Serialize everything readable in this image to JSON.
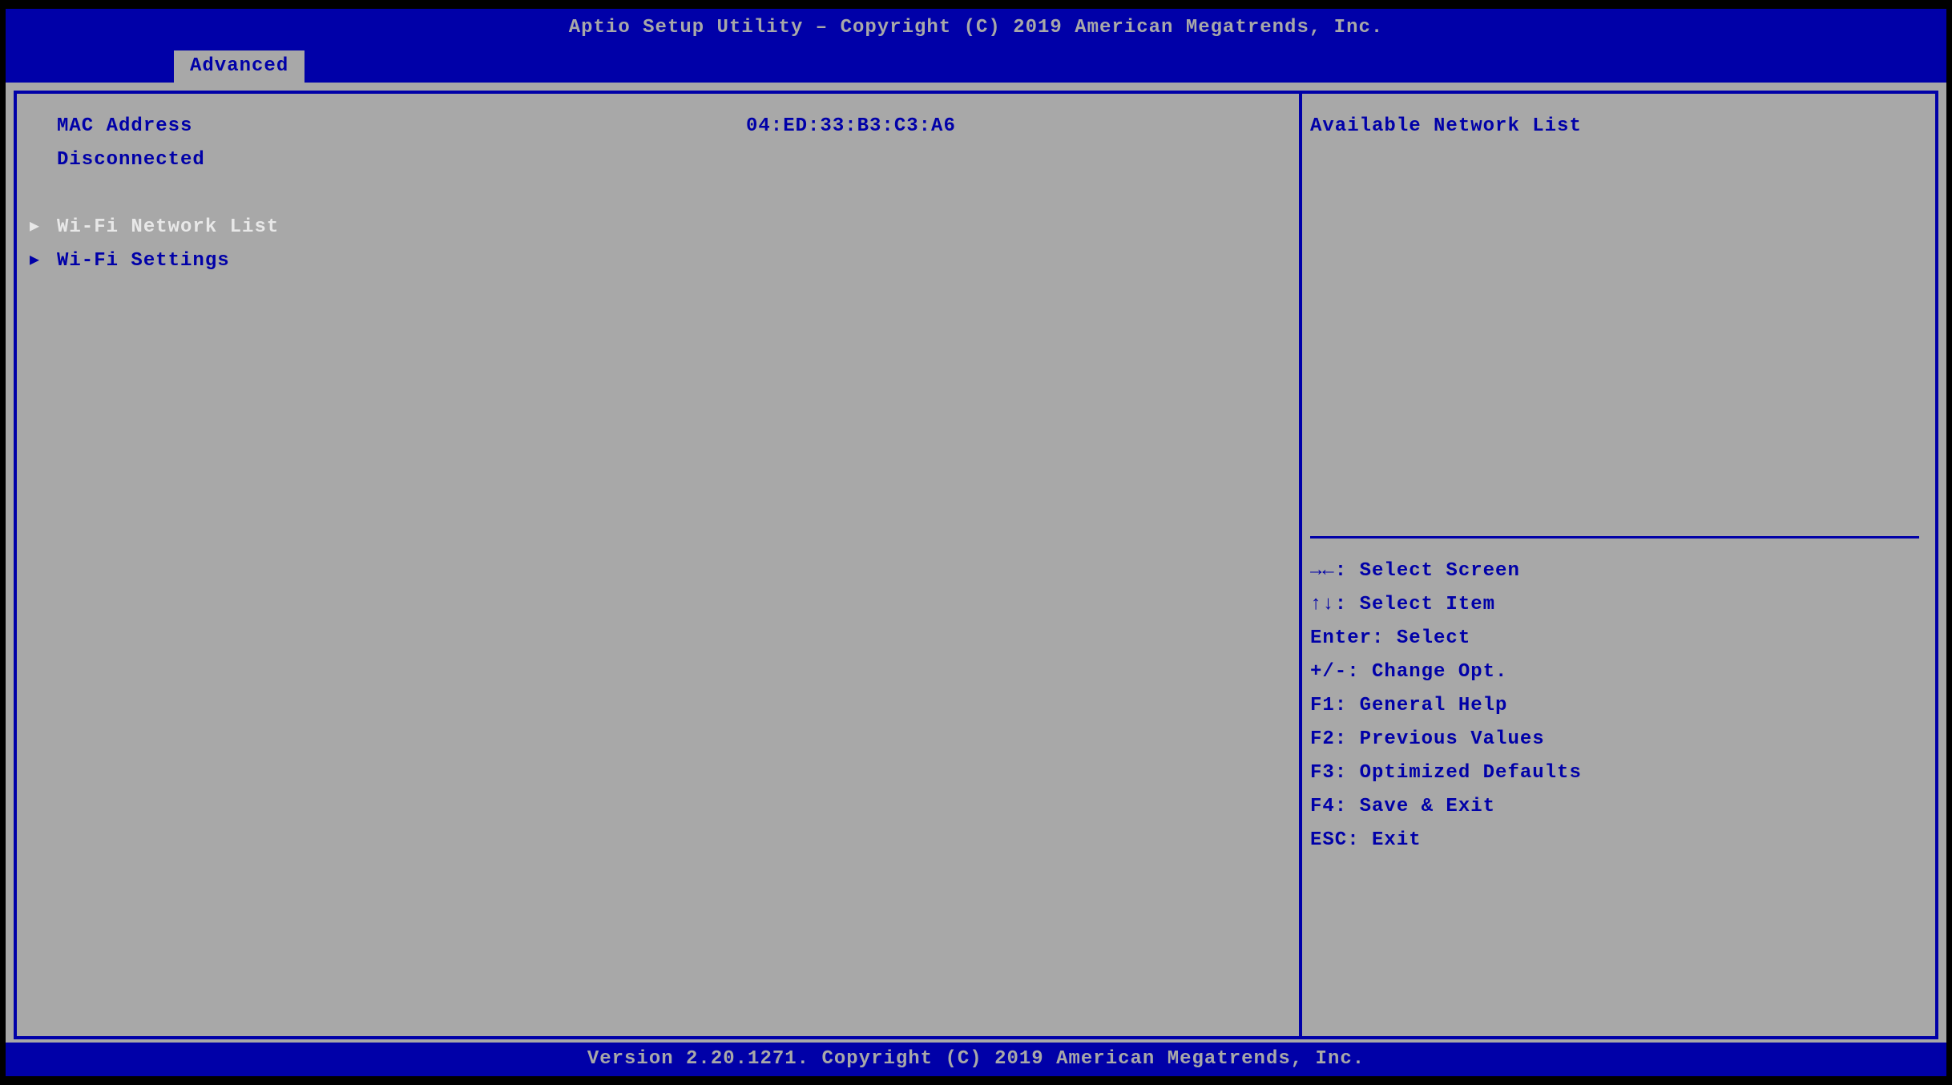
{
  "header": {
    "title": "Aptio Setup Utility – Copyright (C) 2019 American Megatrends, Inc."
  },
  "tab": {
    "label": "Advanced"
  },
  "left": {
    "mac_label": "MAC Address",
    "mac_value": "04:ED:33:B3:C3:A6",
    "status": "Disconnected",
    "menu": [
      {
        "label": "Wi-Fi Network List",
        "selected": true
      },
      {
        "label": "Wi-Fi Settings",
        "selected": false
      }
    ]
  },
  "right": {
    "help_title": "Available Network List",
    "keys": [
      "→←: Select Screen",
      "↑↓: Select Item",
      "Enter: Select",
      "+/-: Change Opt.",
      "F1: General Help",
      "F2: Previous Values",
      "F3: Optimized Defaults",
      "F4: Save & Exit",
      "ESC: Exit"
    ]
  },
  "footer": {
    "text": "Version 2.20.1271. Copyright (C) 2019 American Megatrends, Inc."
  }
}
